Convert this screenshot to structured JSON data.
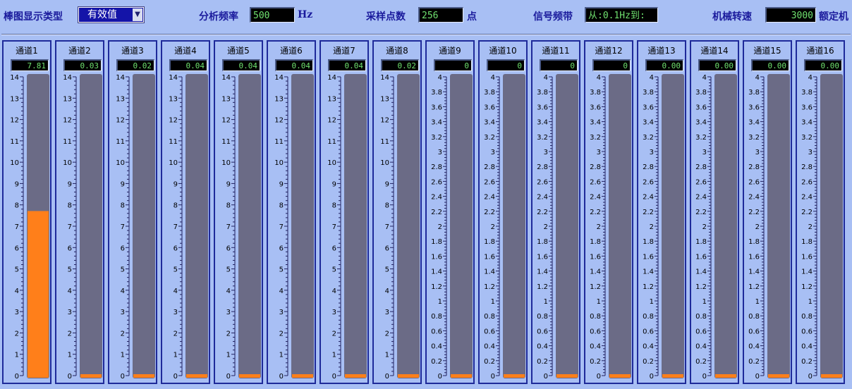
{
  "toolbar": {
    "display_type_label": "棒图显示类型",
    "display_type_value": "有效值",
    "analysis_freq_label": "分析频率",
    "analysis_freq_value": "500",
    "analysis_freq_unit": "Hz",
    "sample_points_label": "采样点数",
    "sample_points_value": "256",
    "sample_points_unit": "点",
    "signal_band_label": "信号频带",
    "signal_band_value": "从:0.1Hz到:",
    "speed_label": "机械转速",
    "speed_value": "3000",
    "rated_label": "额定机"
  },
  "colors": {
    "bar_fill": "#ff7f1a",
    "bar_track": "#6b6b86",
    "lcd_text": "#6fe06f"
  },
  "channels": [
    {
      "name": "通道1",
      "display": "7.81",
      "value": 7.81,
      "max": 14,
      "ticks": [
        "14",
        "13",
        "12",
        "11",
        "10",
        "9",
        "8",
        "7",
        "6",
        "5",
        "4",
        "3",
        "2",
        "1",
        "0"
      ]
    },
    {
      "name": "通道2",
      "display": "0.03",
      "value": 0.03,
      "max": 14,
      "ticks": [
        "14",
        "13",
        "12",
        "11",
        "10",
        "9",
        "8",
        "7",
        "6",
        "5",
        "4",
        "3",
        "2",
        "1",
        "0"
      ]
    },
    {
      "name": "通道3",
      "display": "0.02",
      "value": 0.02,
      "max": 14,
      "ticks": [
        "14",
        "13",
        "12",
        "11",
        "10",
        "9",
        "8",
        "7",
        "6",
        "5",
        "4",
        "3",
        "2",
        "1",
        "0"
      ]
    },
    {
      "name": "通道4",
      "display": "0.04",
      "value": 0.04,
      "max": 14,
      "ticks": [
        "14",
        "13",
        "12",
        "11",
        "10",
        "9",
        "8",
        "7",
        "6",
        "5",
        "4",
        "3",
        "2",
        "1",
        "0"
      ]
    },
    {
      "name": "通道5",
      "display": "0.04",
      "value": 0.04,
      "max": 14,
      "ticks": [
        "14",
        "13",
        "12",
        "11",
        "10",
        "9",
        "8",
        "7",
        "6",
        "5",
        "4",
        "3",
        "2",
        "1",
        "0"
      ]
    },
    {
      "name": "通道6",
      "display": "0.04",
      "value": 0.04,
      "max": 14,
      "ticks": [
        "14",
        "13",
        "12",
        "11",
        "10",
        "9",
        "8",
        "7",
        "6",
        "5",
        "4",
        "3",
        "2",
        "1",
        "0"
      ]
    },
    {
      "name": "通道7",
      "display": "0.04",
      "value": 0.04,
      "max": 14,
      "ticks": [
        "14",
        "13",
        "12",
        "11",
        "10",
        "9",
        "8",
        "7",
        "6",
        "5",
        "4",
        "3",
        "2",
        "1",
        "0"
      ]
    },
    {
      "name": "通道8",
      "display": "0.02",
      "value": 0.02,
      "max": 14,
      "ticks": [
        "14",
        "13",
        "12",
        "11",
        "10",
        "9",
        "8",
        "7",
        "6",
        "5",
        "4",
        "3",
        "2",
        "1",
        "0"
      ]
    },
    {
      "name": "通道9",
      "display": "0",
      "value": 0,
      "max": 4,
      "ticks": [
        "4",
        "3.8",
        "3.6",
        "3.4",
        "3.2",
        "3",
        "2.8",
        "2.6",
        "2.4",
        "2.2",
        "2",
        "1.8",
        "1.6",
        "1.4",
        "1.2",
        "1",
        "0.8",
        "0.6",
        "0.4",
        "0.2",
        "0"
      ]
    },
    {
      "name": "通道10",
      "display": "0",
      "value": 0,
      "max": 4,
      "ticks": [
        "4",
        "3.8",
        "3.6",
        "3.4",
        "3.2",
        "3",
        "2.8",
        "2.6",
        "2.4",
        "2.2",
        "2",
        "1.8",
        "1.6",
        "1.4",
        "1.2",
        "1",
        "0.8",
        "0.6",
        "0.4",
        "0.2",
        "0"
      ]
    },
    {
      "name": "通道11",
      "display": "0",
      "value": 0,
      "max": 4,
      "ticks": [
        "4",
        "3.8",
        "3.6",
        "3.4",
        "3.2",
        "3",
        "2.8",
        "2.6",
        "2.4",
        "2.2",
        "2",
        "1.8",
        "1.6",
        "1.4",
        "1.2",
        "1",
        "0.8",
        "0.6",
        "0.4",
        "0.2",
        "0"
      ]
    },
    {
      "name": "通道12",
      "display": "0",
      "value": 0,
      "max": 4,
      "ticks": [
        "4",
        "3.8",
        "3.6",
        "3.4",
        "3.2",
        "3",
        "2.8",
        "2.6",
        "2.4",
        "2.2",
        "2",
        "1.8",
        "1.6",
        "1.4",
        "1.2",
        "1",
        "0.8",
        "0.6",
        "0.4",
        "0.2",
        "0"
      ]
    },
    {
      "name": "通道13",
      "display": "0.00",
      "value": 0,
      "max": 4,
      "ticks": [
        "4",
        "3.8",
        "3.6",
        "3.4",
        "3.2",
        "3",
        "2.8",
        "2.6",
        "2.4",
        "2.2",
        "2",
        "1.8",
        "1.6",
        "1.4",
        "1.2",
        "1",
        "0.8",
        "0.6",
        "0.4",
        "0.2",
        "0"
      ]
    },
    {
      "name": "通道14",
      "display": "0.00",
      "value": 0,
      "max": 4,
      "ticks": [
        "4",
        "3.8",
        "3.6",
        "3.4",
        "3.2",
        "3",
        "2.8",
        "2.6",
        "2.4",
        "2.2",
        "2",
        "1.8",
        "1.6",
        "1.4",
        "1.2",
        "1",
        "0.8",
        "0.6",
        "0.4",
        "0.2",
        "0"
      ]
    },
    {
      "name": "通道15",
      "display": "0.00",
      "value": 0,
      "max": 4,
      "ticks": [
        "4",
        "3.8",
        "3.6",
        "3.4",
        "3.2",
        "3",
        "2.8",
        "2.6",
        "2.4",
        "2.2",
        "2",
        "1.8",
        "1.6",
        "1.4",
        "1.2",
        "1",
        "0.8",
        "0.6",
        "0.4",
        "0.2",
        "0"
      ]
    },
    {
      "name": "通道16",
      "display": "0.00",
      "value": 0,
      "max": 4,
      "ticks": [
        "4",
        "3.8",
        "3.6",
        "3.4",
        "3.2",
        "3",
        "2.8",
        "2.6",
        "2.4",
        "2.2",
        "2",
        "1.8",
        "1.6",
        "1.4",
        "1.2",
        "1",
        "0.8",
        "0.6",
        "0.4",
        "0.2",
        "0"
      ]
    }
  ]
}
